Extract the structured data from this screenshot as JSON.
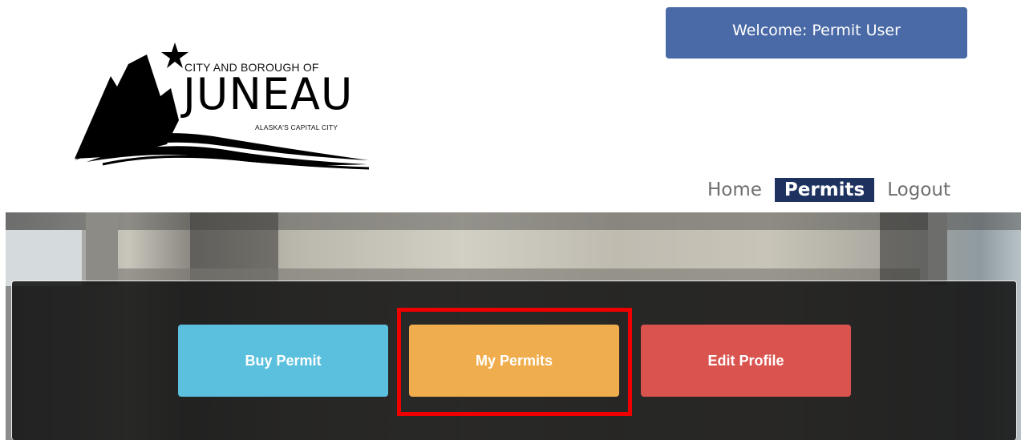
{
  "logo": {
    "line1": "CITY AND BOROUGH OF",
    "line2": "JUNEAU",
    "line3": "ALASKA'S CAPITAL CITY",
    "icon": "star-mountain-logo"
  },
  "header": {
    "welcome": "Welcome:  Permit User"
  },
  "nav": {
    "items": [
      {
        "label": "Home"
      },
      {
        "label": "Permits"
      },
      {
        "label": "Logout"
      }
    ],
    "active": "Permits"
  },
  "actions": {
    "buy": "Buy Permit",
    "my": "My Permits",
    "edit": "Edit Profile"
  },
  "colors": {
    "welcome_bg": "#4a6aa7",
    "nav_active_bg": "#1e3260",
    "buy": "#5bc0de",
    "my": "#f0ad4e",
    "edit": "#d9534f",
    "highlight": "#ee0000"
  }
}
